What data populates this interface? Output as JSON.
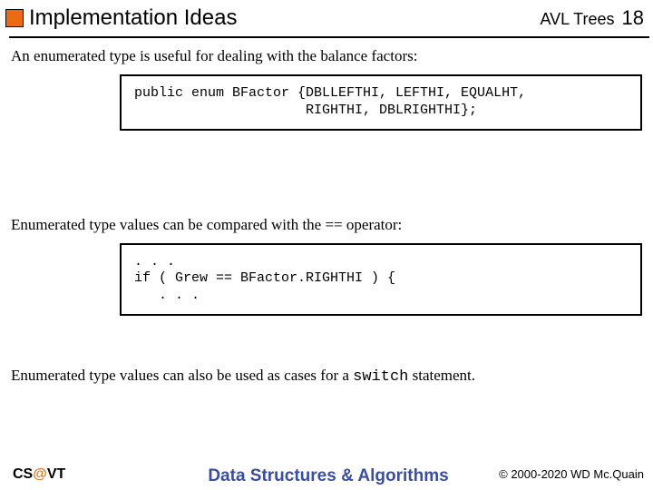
{
  "header": {
    "title": "Implementation Ideas",
    "topic": "AVL Trees",
    "page": "18"
  },
  "body": {
    "p1": "An enumerated type is useful for dealing with the balance factors:",
    "code1": "public enum BFactor {DBLLEFTHI, LEFTHI, EQUALHT,\n                     RIGHTHI, DBLRIGHTHI};",
    "p2": "Enumerated type values can be compared with the == operator:",
    "code2": ". . .\nif ( Grew == BFactor.RIGHTHI ) {\n   . . .",
    "p3_a": "Enumerated type values can also be used as cases for a ",
    "p3_code": "switch",
    "p3_b": " statement."
  },
  "footer": {
    "left_a": "CS",
    "left_at": "@",
    "left_b": "VT",
    "center": "Data Structures & Algorithms",
    "right": "© 2000-2020 WD Mc.Quain"
  }
}
